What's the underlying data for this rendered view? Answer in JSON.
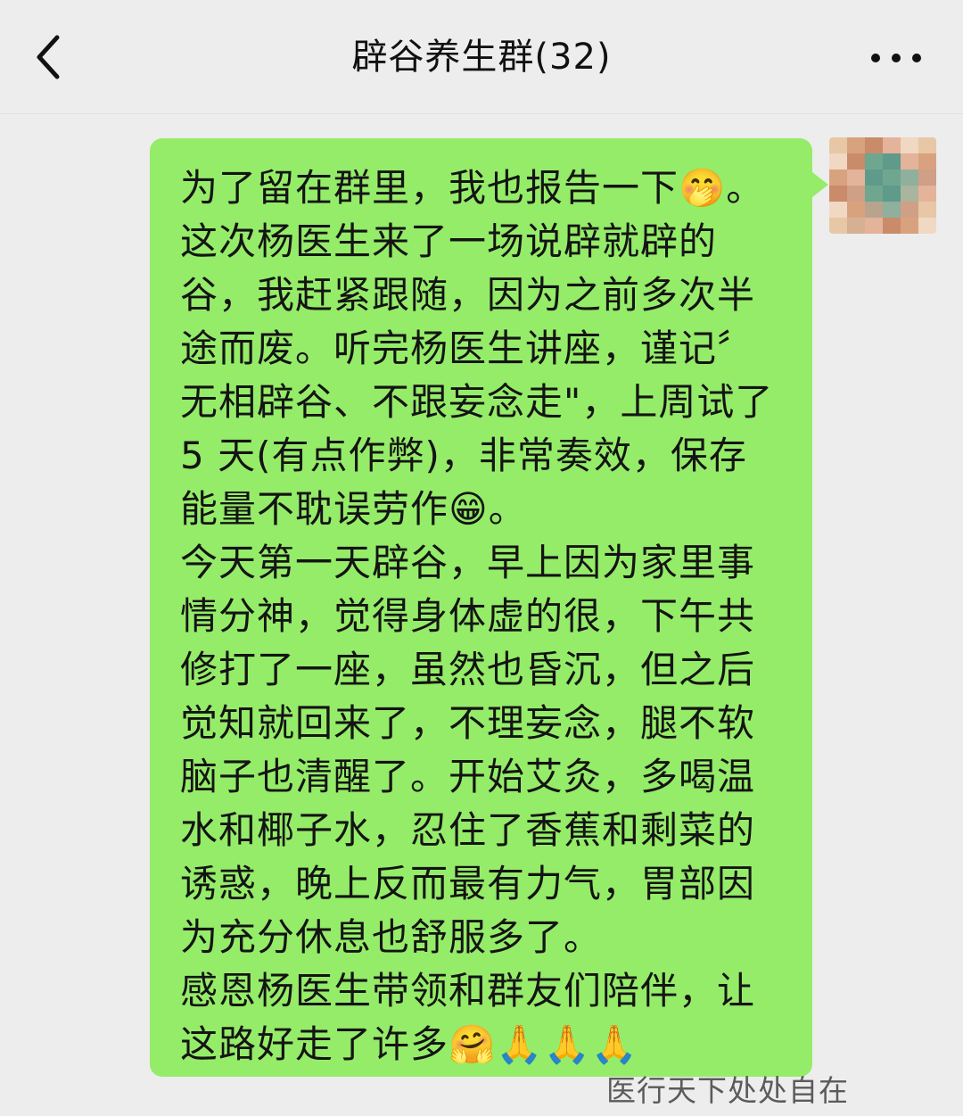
{
  "header": {
    "back_icon": "chevron-left-icon",
    "title": "辟谷养生群(32)",
    "more_icon": "more-dots-icon"
  },
  "message": {
    "sender_avatar": "pixelated-avatar",
    "lines": [
      "为了留在群里，我也报告一下🤭。",
      "这次杨医生来了一场说辟就辟的谷，我赶紧跟随，因为之前多次半途而废。听完杨医生讲座，谨记〞无相辟谷、不跟妄念走\"，上周试了 5 天(有点作弊)，非常奏效，保存能量不耽误劳作😁。",
      "今天第一天辟谷，早上因为家里事情分神，觉得身体虚的很，下午共修打了一座，虽然也昏沉，但之后觉知就回来了，不理妄念，腿不软脑子也清醒了。开始艾灸，多喝温水和椰子水，忍住了香蕉和剩菜的诱惑，晚上反而最有力气，胃部因为充分休息也舒服多了。",
      "感恩杨医生带领和群友们陪伴，让这路好走了许多🤗🙏🙏🙏"
    ]
  },
  "watermark": "医行天下处处自在",
  "colors": {
    "background": "#ededed",
    "bubble": "#95ec69",
    "text": "#141414"
  }
}
